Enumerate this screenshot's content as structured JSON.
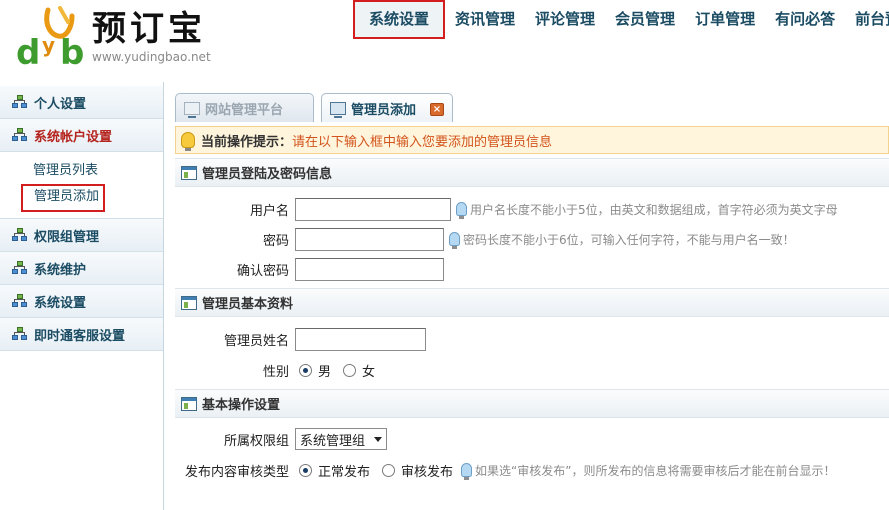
{
  "header": {
    "logo_text": "预订宝",
    "logo_url": "www.yudingbao.net",
    "nav": [
      {
        "label": "系统设置",
        "active": true
      },
      {
        "label": "资讯管理"
      },
      {
        "label": "评论管理"
      },
      {
        "label": "会员管理"
      },
      {
        "label": "订单管理"
      },
      {
        "label": "有问必答"
      },
      {
        "label": "前台预"
      }
    ]
  },
  "sidebar": {
    "groups": [
      {
        "label": "个人设置"
      },
      {
        "label": "系统帐户设置",
        "open": true,
        "items": [
          {
            "label": "管理员列表"
          },
          {
            "label": "管理员添加",
            "active": true
          }
        ]
      },
      {
        "label": "权限组管理"
      },
      {
        "label": "系统维护"
      },
      {
        "label": "系统设置"
      },
      {
        "label": "即时通客服设置"
      }
    ]
  },
  "tabs": [
    {
      "label": "网站管理平台"
    },
    {
      "label": "管理员添加",
      "active": true
    }
  ],
  "hint": {
    "label": "当前操作提示：",
    "text": "请在以下输入框中输入您要添加的管理员信息"
  },
  "sections": {
    "login": {
      "title": "管理员登陆及密码信息",
      "username_label": "用户名",
      "username_value": "",
      "username_tip": "用户名长度不能小于5位，由英文和数据组成，首字符必须为英文字母",
      "password_label": "密码",
      "password_value": "",
      "password_tip": "密码长度不能小于6位，可输入任何字符，不能与用户名一致！",
      "confirm_label": "确认密码",
      "confirm_value": ""
    },
    "basic": {
      "title": "管理员基本资料",
      "name_label": "管理员姓名",
      "name_value": "",
      "gender_label": "性别",
      "gender_options": [
        "男",
        "女"
      ],
      "gender_selected": "男"
    },
    "ops": {
      "title": "基本操作设置",
      "group_label": "所属权限组",
      "group_value": "系统管理组",
      "review_label": "发布内容审核类型",
      "review_options": [
        "正常发布",
        "审核发布"
      ],
      "review_selected": "正常发布",
      "review_tip": "如果选“审核发布”，则所发布的信息将需要审核后才能在前台显示！"
    }
  },
  "colors": {
    "nav_text": "#1b4c63",
    "highlight_border": "#d21e1e",
    "hint_text": "#d2541c",
    "tip_text": "#8b8b8b"
  }
}
